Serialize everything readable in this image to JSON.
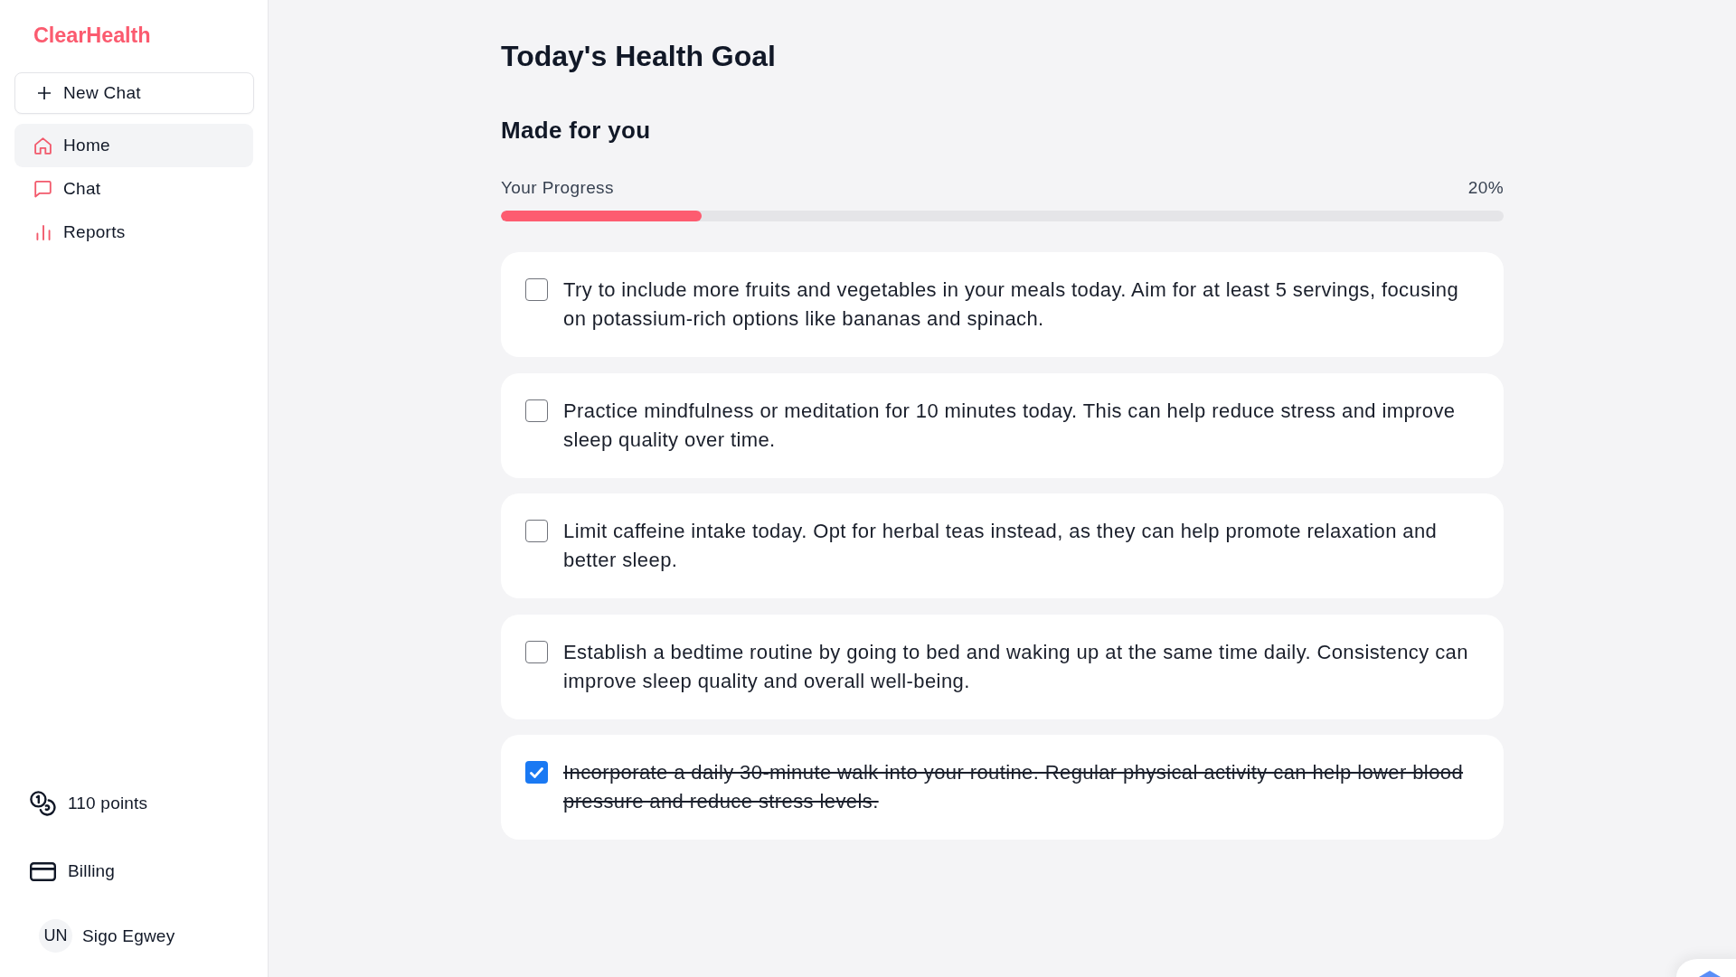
{
  "sidebar": {
    "logo": "ClearHealth",
    "new_chat_button": "New Chat",
    "nav_items": [
      {
        "label": "Home",
        "kind": "home",
        "selected": true
      },
      {
        "label": "Chat",
        "kind": "chat",
        "selected": false
      },
      {
        "label": "Reports",
        "kind": "reports",
        "selected": false
      }
    ],
    "points": "110 points",
    "billing": "Billing",
    "user": {
      "initials": "UN",
      "name": "Sigo Egwey"
    }
  },
  "main": {
    "title": "Today's Health Goal",
    "subtitle": "Made for you",
    "progress": {
      "label": "Your Progress",
      "reading": "20%",
      "level": 0.2
    },
    "goals": [
      {
        "text": "Try to include more fruits and vegetables in your meals today. Aim for at least 5 servings, focusing on potassium-rich options like bananas and spinach.",
        "checked": false
      },
      {
        "text": "Practice mindfulness or meditation for 10 minutes today. This can help reduce stress and improve sleep quality over time.",
        "checked": false
      },
      {
        "text": "Limit caffeine intake today. Opt for herbal teas instead, as they can help promote relaxation and better sleep.",
        "checked": false
      },
      {
        "text": "Establish a bedtime routine by going to bed and waking up at the same time daily. Consistency can improve sleep quality and overall well-being.",
        "checked": false
      },
      {
        "text": "Incorporate a daily 30-minute walk into your routine. Regular physical activity can help lower blood pressure and reduce stress levels.",
        "checked": true
      }
    ]
  }
}
